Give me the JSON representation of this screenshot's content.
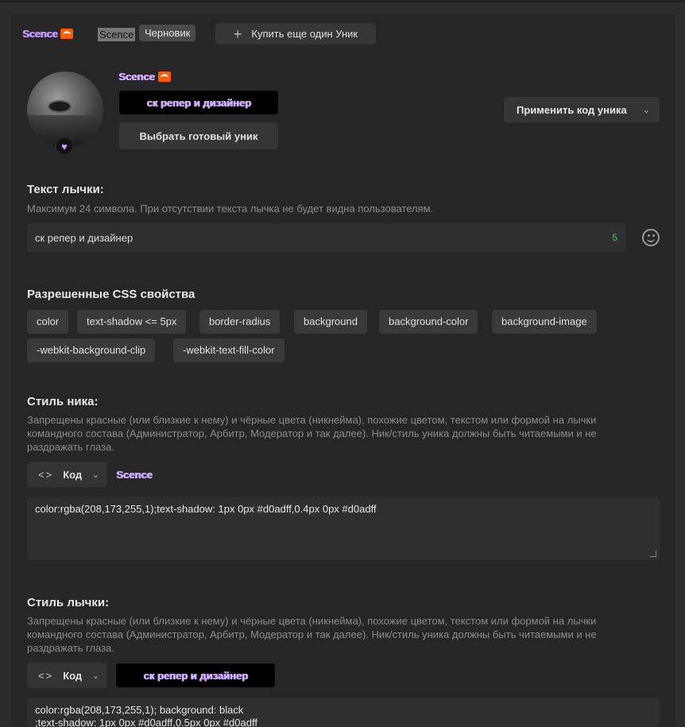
{
  "tabs": {
    "active_label": "Scence",
    "ghost_label": "Scence",
    "draft_badge": "Черновик",
    "buy_button": "Купить еще один Уник"
  },
  "profile": {
    "nick": "Scence",
    "badge_text": "ск репер и дизайнер",
    "choose_button": "Выбрать готовый уник",
    "apply_code_button": "Применить код уника"
  },
  "badge_text_section": {
    "heading": "Текст лычки:",
    "hint": "Максимум 24 символа. При отсутствии текста лычка не будет видна пользователям.",
    "value": "ск репер и дизайнер",
    "counter": "5"
  },
  "css_props": {
    "heading": "Разрешенные CSS свойства",
    "chips": [
      "color",
      "text-shadow <= 5px",
      "border-radius",
      "background",
      "background-color",
      "background-image",
      "-webkit-background-clip",
      "-webkit-text-fill-color"
    ]
  },
  "nick_style": {
    "heading": "Стиль ника:",
    "hint": "Запрещены красные (или близкие к нему) и чёрные цвета (никнейма), похожие цветом, текстом или формой на лычки командного состава (Администратор, Арбитр, Модератор и так далее). Ник/стиль уника должны быть читаемыми и не раздражать глаза.",
    "mode": "Код",
    "preview": "Scence",
    "code": "color:rgba(208,173,255,1);text-shadow: 1px 0px #d0adff,0.4px 0px #d0adff"
  },
  "badge_style": {
    "heading": "Стиль лычки:",
    "hint": "Запрещены красные (или близкие к нему) и чёрные цвета (никнейма), похожие цветом, текстом или формой на лычки командного состава (Администратор, Арбитр, Модератор и так далее). Ник/стиль уника должны быть читаемыми и не раздражать глаза.",
    "mode": "Код",
    "preview": "ск репер и дизайнер",
    "code_line1": "color:rgba(208,173,255,1); background: black",
    "code_line2": ";text-shadow: 1px 0px #d0adff,0.5px 0px #d0adff"
  },
  "colors": {
    "accent": "#d0adff",
    "soundcloud": "#ff5a00",
    "counter_green": "#3fc16e"
  },
  "icons": [
    "soundcloud-icon",
    "plus-icon",
    "heart-icon",
    "smiley-icon",
    "code-icon",
    "chevron-down-icon"
  ]
}
